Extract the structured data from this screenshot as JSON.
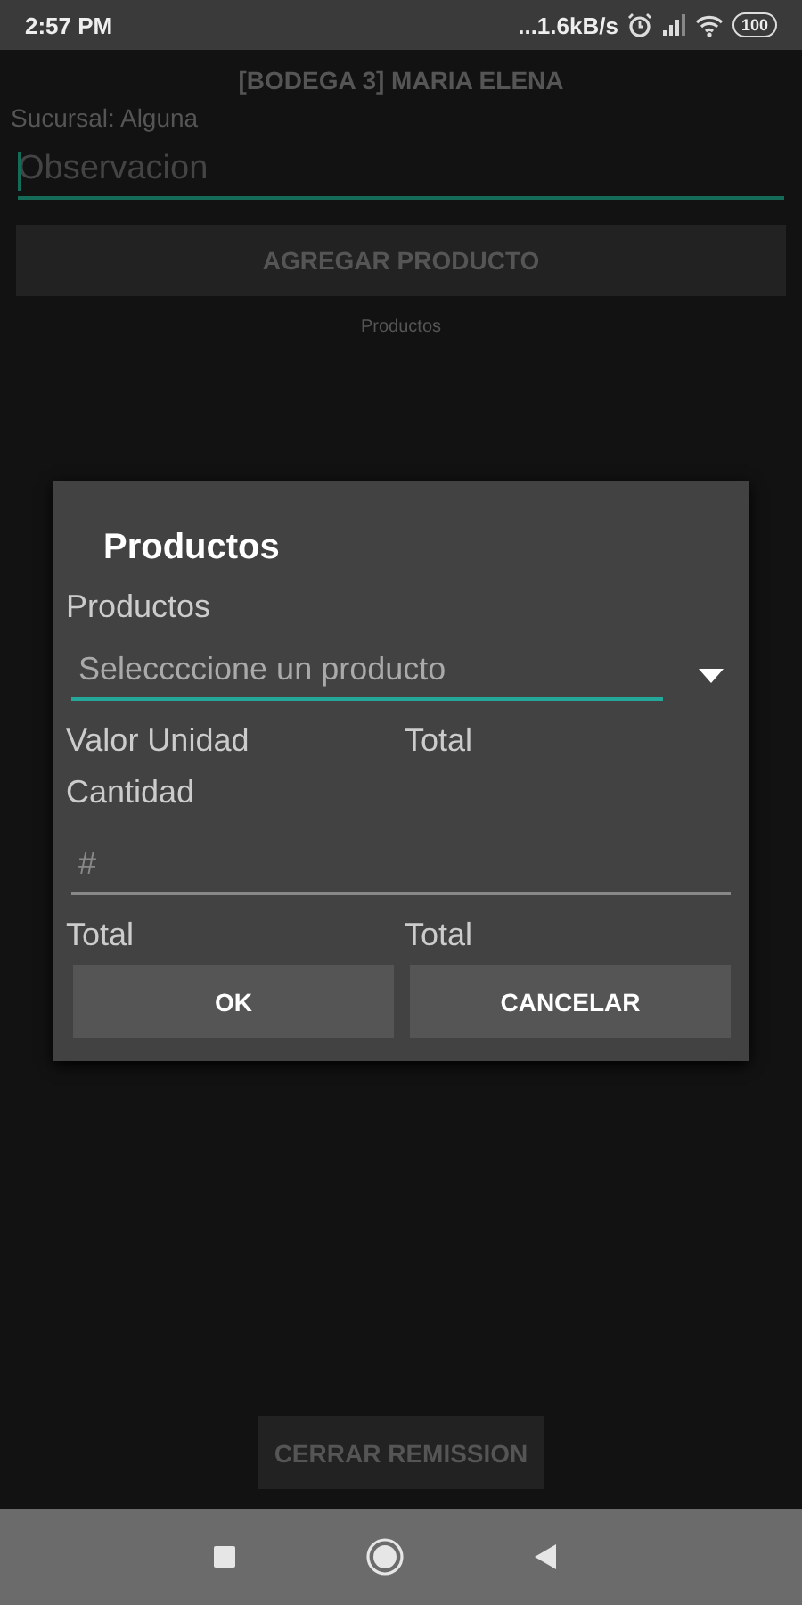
{
  "status_bar": {
    "time": "2:57 PM",
    "speed": "...1.6kB/s",
    "battery": "100"
  },
  "header": {
    "title": "[BODEGA 3] MARIA ELENA",
    "branch": "Sucursal: Alguna"
  },
  "observation": {
    "placeholder": "Observacion"
  },
  "add_button": "AGREGAR PRODUCTO",
  "products_label": "Productos",
  "dialog": {
    "title": "Productos",
    "product_label": "Productos",
    "product_select": {
      "placeholder": "Seleccccione un producto"
    },
    "unit_value_label": "Valor Unidad",
    "unit_total_label": "Total",
    "quantity_label": "Cantidad",
    "quantity_field": {
      "placeholder": "#"
    },
    "total_label": "Total",
    "total_value": "Total",
    "buttons": [
      "OK",
      "CANCELAR"
    ]
  },
  "close_button": "CERRAR REMISSION"
}
